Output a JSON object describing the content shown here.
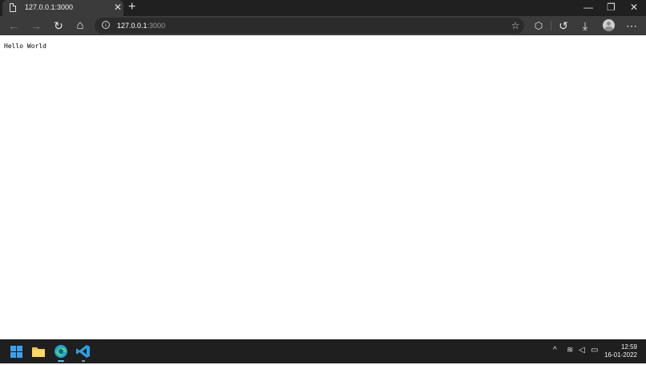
{
  "browser": {
    "tab": {
      "title": "127.0.0.1:3000",
      "close_glyph": "✕"
    },
    "new_tab_glyph": "+",
    "window_controls": {
      "minimize": "—",
      "restore": "❐",
      "close": "✕"
    },
    "address_bar": {
      "host": "127.0.0.1",
      "port": ":3000"
    },
    "toolbar_glyphs": {
      "back": "←",
      "forward": "→",
      "refresh": "↻",
      "home": "⌂",
      "favorites": "☆",
      "extensions": "⬡",
      "history": "↺",
      "downloads": "⤓",
      "more": "⋯"
    }
  },
  "page": {
    "text": "Hello World"
  },
  "taskbar": {
    "apps": [
      "start",
      "file-explorer",
      "microsoft-edge",
      "visual-studio-code"
    ],
    "tray_glyphs": {
      "chevron": "^",
      "wifi": "≋",
      "volume": "◁",
      "battery": "▭"
    },
    "clock": {
      "time": "12:59",
      "date": "16-01-2022"
    }
  },
  "colors": {
    "titlebar": "#202020",
    "toolbar": "#3b3b3b",
    "address_bar": "#2b2b2b",
    "taskbar": "#1f1f1f",
    "windows_blue": "#3aa0f0",
    "vscode_blue": "#2d9fe6",
    "folder_yellow": "#f6c342"
  }
}
